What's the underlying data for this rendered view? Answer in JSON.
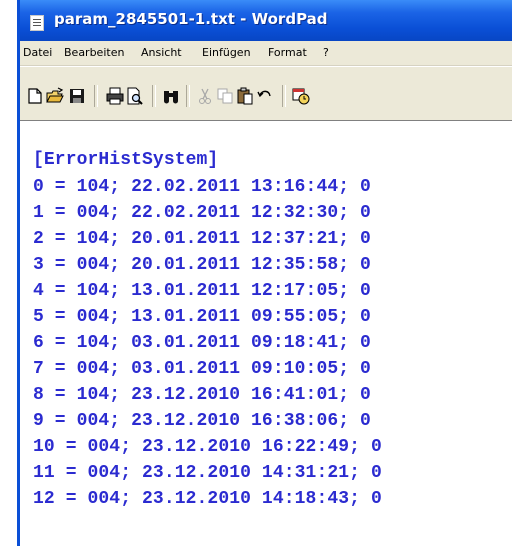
{
  "window": {
    "title": "param_2845501-1.txt - WordPad"
  },
  "menu": [
    {
      "label": "Datei"
    },
    {
      "label": "Bearbeiten"
    },
    {
      "label": "Ansicht"
    },
    {
      "label": "Einfügen"
    },
    {
      "label": "Format"
    },
    {
      "label": "?"
    }
  ],
  "toolbar": {
    "icons": [
      "new-document-icon",
      "open-folder-icon",
      "save-disk-icon",
      "print-icon",
      "print-preview-icon",
      "find-binoculars-icon",
      "cut-scissors-icon",
      "copy-icon",
      "paste-icon",
      "undo-icon",
      "insert-date-time-icon"
    ]
  },
  "document": {
    "text_color": "#2b2bd0",
    "lines": [
      "[ErrorHistSystem]",
      "0 = 104; 22.02.2011 13:16:44; 0",
      "1 = 004; 22.02.2011 12:32:30; 0",
      "2 = 104; 20.01.2011 12:37:21; 0",
      "3 = 004; 20.01.2011 12:35:58; 0",
      "4 = 104; 13.01.2011 12:17:05; 0",
      "5 = 004; 13.01.2011 09:55:05; 0",
      "6 = 104; 03.01.2011 09:18:41; 0",
      "7 = 004; 03.01.2011 09:10:05; 0",
      "8 = 104; 23.12.2010 16:41:01; 0",
      "9 = 004; 23.12.2010 16:38:06; 0",
      "10 = 004; 23.12.2010 16:22:49; 0",
      "11 = 004; 23.12.2010 14:31:21; 0",
      "12 = 004; 23.12.2010 14:18:43; 0"
    ]
  }
}
